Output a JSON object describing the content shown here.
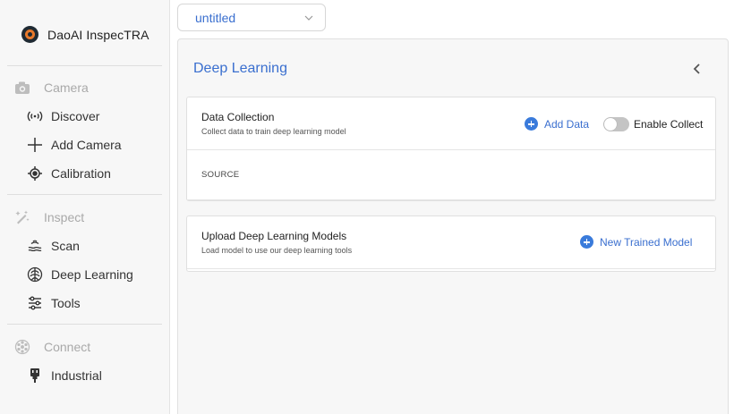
{
  "app": {
    "name": "DaoAI InspecTRA"
  },
  "project": {
    "selected": "untitled"
  },
  "sidebar": {
    "sections": [
      {
        "title": "Camera",
        "icon": "camera-icon",
        "items": [
          {
            "label": "Discover",
            "icon": "broadcast-icon"
          },
          {
            "label": "Add Camera",
            "icon": "plus-icon"
          },
          {
            "label": "Calibration",
            "icon": "crosshair-icon"
          }
        ]
      },
      {
        "title": "Inspect",
        "icon": "magic-wand-icon",
        "items": [
          {
            "label": "Scan",
            "icon": "scan-waves-icon"
          },
          {
            "label": "Deep Learning",
            "icon": "brain-icon"
          },
          {
            "label": "Tools",
            "icon": "sliders-icon"
          }
        ]
      },
      {
        "title": "Connect",
        "icon": "network-icon",
        "items": [
          {
            "label": "Industrial",
            "icon": "plug-icon"
          }
        ]
      }
    ]
  },
  "main": {
    "title": "Deep Learning",
    "data_collection": {
      "title": "Data Collection",
      "subtitle": "Collect data to train deep learning model",
      "add_label": "Add Data",
      "toggle_label": "Enable Collect",
      "toggle_on": false,
      "source_label": "SOURCE"
    },
    "upload_models": {
      "title": "Upload Deep Learning Models",
      "subtitle": "Load model to use our deep learning tools",
      "new_label": "New Trained Model"
    }
  },
  "colors": {
    "accent": "#3a6fcf",
    "icon_blue": "#3a7bdb",
    "muted": "#a9a9a9"
  }
}
